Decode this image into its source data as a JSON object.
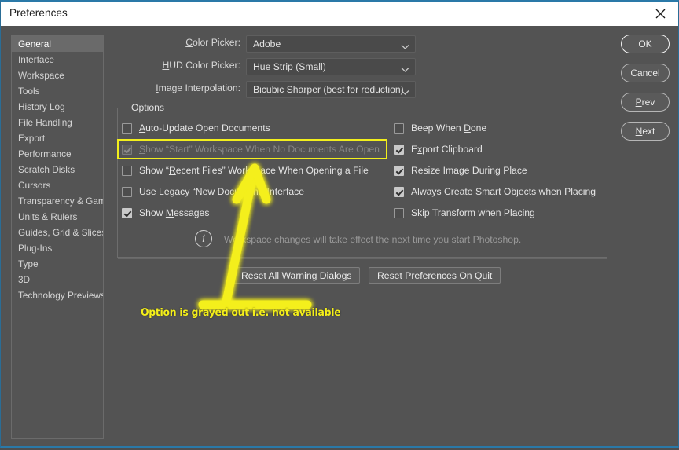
{
  "window": {
    "title": "Preferences",
    "close_icon": "close-icon"
  },
  "sidebar": {
    "items": [
      {
        "label": "General",
        "selected": true
      },
      {
        "label": "Interface",
        "selected": false
      },
      {
        "label": "Workspace",
        "selected": false
      },
      {
        "label": "Tools",
        "selected": false
      },
      {
        "label": "History Log",
        "selected": false
      },
      {
        "label": "File Handling",
        "selected": false
      },
      {
        "label": "Export",
        "selected": false
      },
      {
        "label": "Performance",
        "selected": false
      },
      {
        "label": "Scratch Disks",
        "selected": false
      },
      {
        "label": "Cursors",
        "selected": false
      },
      {
        "label": "Transparency & Gamut",
        "selected": false
      },
      {
        "label": "Units & Rulers",
        "selected": false
      },
      {
        "label": "Guides, Grid & Slices",
        "selected": false
      },
      {
        "label": "Plug-Ins",
        "selected": false
      },
      {
        "label": "Type",
        "selected": false
      },
      {
        "label": "3D",
        "selected": false
      },
      {
        "label": "Technology Previews",
        "selected": false
      }
    ]
  },
  "actions": {
    "ok": "OK",
    "cancel": "Cancel",
    "prev": "Prev",
    "next": "Next"
  },
  "fields": [
    {
      "label": "Color Picker:",
      "accel": "C",
      "value": "Adobe"
    },
    {
      "label": "HUD Color Picker:",
      "accel": "H",
      "value": "Hue Strip (Small)"
    },
    {
      "label": "Image Interpolation:",
      "accel": "I",
      "value": "Bicubic Sharper (best for reduction)"
    }
  ],
  "options": {
    "legend": "Options",
    "left_column": [
      {
        "label": "Auto-Update Open Documents",
        "accel": "A",
        "checked": false,
        "disabled": false
      },
      {
        "label": "Show “Start” Workspace When No Documents Are Open",
        "accel": "S",
        "checked": true,
        "disabled": true
      },
      {
        "label": "Show “Recent Files” Workspace When Opening a File",
        "accel": "R",
        "checked": false,
        "disabled": false
      },
      {
        "label": "Use Legacy “New Document” Interface",
        "accel": "",
        "checked": false,
        "disabled": false
      },
      {
        "label": "Show Messages",
        "accel": "M",
        "checked": true,
        "disabled": false
      }
    ],
    "right_column": [
      {
        "label": "Beep When Done",
        "accel": "D",
        "checked": false,
        "disabled": false
      },
      {
        "label": "Export Clipboard",
        "accel": "x",
        "checked": true,
        "disabled": false
      },
      {
        "label": "Resize Image During Place",
        "accel": "g",
        "checked": true,
        "disabled": false
      },
      {
        "label": "Always Create Smart Objects when Placing",
        "accel": "j",
        "checked": true,
        "disabled": false
      },
      {
        "label": "Skip Transform when Placing",
        "accel": "",
        "checked": false,
        "disabled": false
      }
    ],
    "info_icon": "info-circle-icon",
    "info_text": "Workspace changes will take effect the next time you start Photoshop.",
    "reset_warnings": "Reset All Warning Dialogs",
    "reset_warnings_accel": "W",
    "reset_on_quit": "Reset Preferences On Quit"
  },
  "annotation": {
    "text": "Option is grayed out i.e. not available",
    "highlight_color": "#f2ef1c",
    "arrow_color": "#f4ef1a"
  }
}
